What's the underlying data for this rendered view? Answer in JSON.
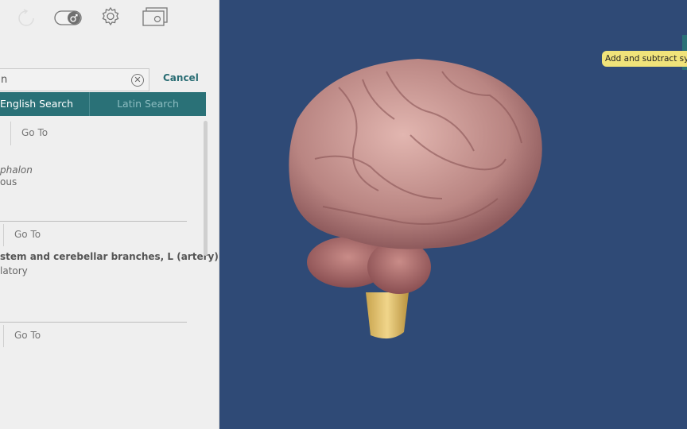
{
  "toolbar": {
    "icons": [
      "reset-icon",
      "sex-toggle-male-icon",
      "gear-icon",
      "screens-icon"
    ]
  },
  "search": {
    "value": "n",
    "cancel_label": "Cancel"
  },
  "tabs": [
    {
      "label": "English Search",
      "selected": true
    },
    {
      "label": "Latin Search",
      "selected": false
    }
  ],
  "results": [
    {
      "goto": "Go To",
      "title": "phalon",
      "subtitle": "ous"
    },
    {
      "goto": "Go To",
      "title": "stem and cerebellar branches, L (artery)",
      "subtitle": "latory"
    },
    {
      "goto": "Go To"
    }
  ],
  "viewport": {
    "tooltip": "Add and subtract systems",
    "background": "#2f4a76",
    "accent": "#2a7177"
  }
}
